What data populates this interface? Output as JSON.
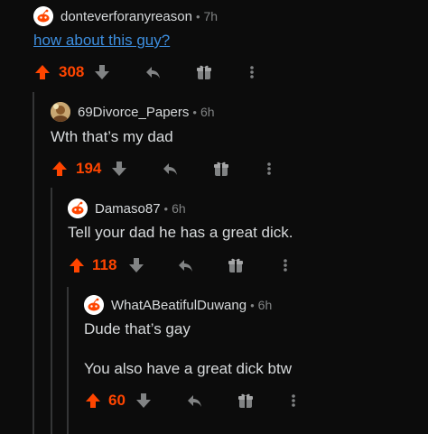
{
  "colors": {
    "background": "#0c0c0c",
    "upvote": "#ff4500",
    "link": "#3d8ede",
    "text": "#d7dadc",
    "muted": "#818384",
    "thread_line": "#343536"
  },
  "comments": [
    {
      "username": "donteverforanyreason",
      "age": "7h",
      "body": [
        "how about this guy?"
      ],
      "body_is_link": true,
      "score": "308",
      "avatar_icon": "snoo-avatar-icon",
      "upvoted": true
    },
    {
      "username": "69Divorce_Papers",
      "age": "6h",
      "body": [
        "Wth that’s my dad"
      ],
      "score": "194",
      "avatar_icon": "photo-avatar-icon",
      "upvoted": true
    },
    {
      "username": "Damaso87",
      "age": "6h",
      "body": [
        "Tell your dad he has a great dick."
      ],
      "score": "118",
      "avatar_icon": "snoo-avatar-icon",
      "upvoted": true
    },
    {
      "username": "WhatABeatifulDuwang",
      "age": "6h",
      "body": [
        "Dude that’s gay",
        "You also have a great dick btw"
      ],
      "score": "60",
      "avatar_icon": "snoo-avatar-icon",
      "upvoted": true
    }
  ],
  "separator": "•",
  "action_icons": [
    "upvote-icon",
    "downvote-icon",
    "reply-icon",
    "award-icon",
    "more-options-icon"
  ]
}
